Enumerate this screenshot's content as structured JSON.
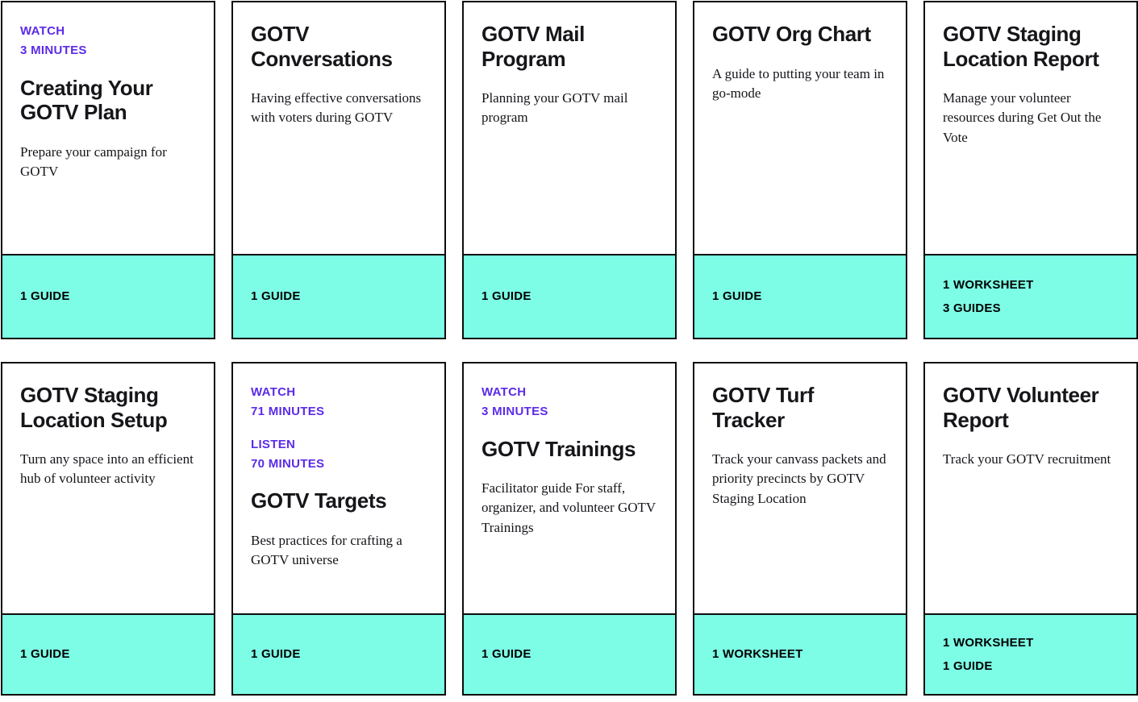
{
  "theme": {
    "accent_purple": "#5B2BE8",
    "footer_teal": "#7DFCE6",
    "border_black": "#0D0D0D",
    "text_black": "#16161A",
    "card_background": "#FFFFFF"
  },
  "cards": [
    {
      "media": [
        {
          "type_label": "WATCH",
          "duration_label": "3 MINUTES"
        }
      ],
      "title": "Creating Your GOTV Plan",
      "description": "Prepare your campaign for GOTV",
      "footer": [
        "1 GUIDE"
      ]
    },
    {
      "media": [],
      "title": "GOTV Conversations",
      "description": "Having effective conversations with voters during GOTV",
      "footer": [
        "1 GUIDE"
      ]
    },
    {
      "media": [],
      "title": "GOTV Mail Program",
      "description": "Planning your GOTV mail program",
      "footer": [
        "1 GUIDE"
      ]
    },
    {
      "media": [],
      "title": "GOTV Org Chart",
      "description": "A guide to putting your team in go-mode",
      "footer": [
        "1 GUIDE"
      ]
    },
    {
      "media": [],
      "title": "GOTV Staging Location Report",
      "description": "Manage your volunteer resources during Get Out the Vote",
      "footer": [
        "1 WORKSHEET",
        "3 GUIDES"
      ]
    },
    {
      "media": [],
      "title": "GOTV Staging Location Setup",
      "description": "Turn any space into an efficient hub of volunteer activity",
      "footer": [
        "1 GUIDE"
      ]
    },
    {
      "media": [
        {
          "type_label": "WATCH",
          "duration_label": "71 MINUTES"
        },
        {
          "type_label": "LISTEN",
          "duration_label": "70 MINUTES"
        }
      ],
      "title": "GOTV Targets",
      "description": "Best practices for crafting a GOTV universe",
      "footer": [
        "1 GUIDE"
      ]
    },
    {
      "media": [
        {
          "type_label": "WATCH",
          "duration_label": "3 MINUTES"
        }
      ],
      "title": "GOTV Trainings",
      "description": "Facilitator guide For staff, organizer, and volunteer GOTV Trainings",
      "footer": [
        "1 GUIDE"
      ]
    },
    {
      "media": [],
      "title": "GOTV Turf Tracker",
      "description": "Track your canvass packets and priority precincts by GOTV Staging Location",
      "footer": [
        "1 WORKSHEET"
      ]
    },
    {
      "media": [],
      "title": "GOTV Volunteer Report",
      "description": "Track your GOTV recruitment",
      "footer": [
        "1 WORKSHEET",
        "1 GUIDE"
      ]
    }
  ]
}
